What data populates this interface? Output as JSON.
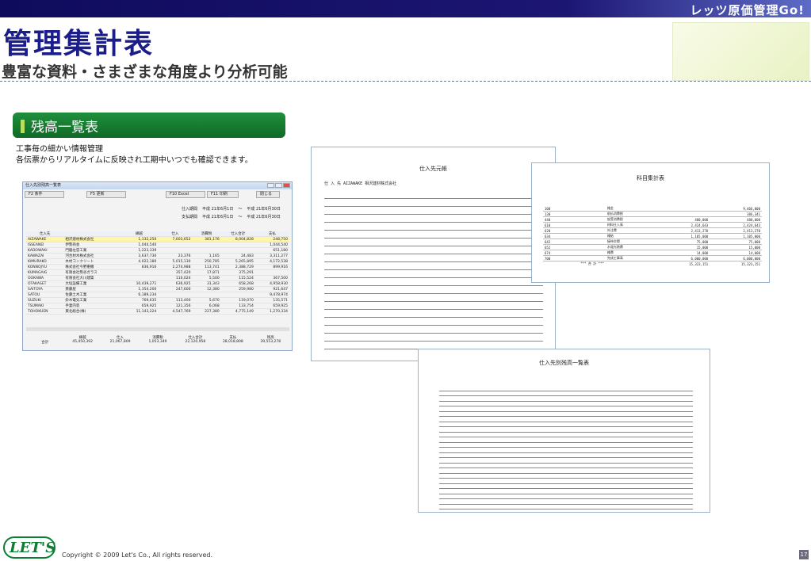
{
  "brand": "レッツ原価管理Go!",
  "title": "管理集計表",
  "subtitle": "豊富な資料・さまざまな角度より分析可能",
  "section": "残高一覧表",
  "description": [
    "工事毎の細かい情報管理",
    "各伝票からリアルタイムに反映され工期中いつでも確認できます。"
  ],
  "app": {
    "window_title": "仕入先別残高一覧表",
    "buttons": [
      "F2 条件",
      "F5 更新",
      "F10 Excel",
      "F11 印刷",
      "閉じる"
    ],
    "periods": [
      {
        "label": "仕入期間",
        "from": "平成 21年6月1日",
        "sep": "〜",
        "to": "平成 21年6月30日"
      },
      {
        "label": "支払期間",
        "from": "平成 21年6月1日",
        "sep": "〜",
        "to": "平成 21年6月30日"
      }
    ],
    "columns": [
      "仕入先",
      "",
      "繰越",
      "仕入",
      "消費税",
      "仕入合計",
      "支払",
      "残高"
    ],
    "rows": [
      [
        "AIZAWAKE",
        "相沢建材株式会社",
        "1,132,250",
        "7,603,652",
        "381,176",
        "8,004,828",
        "248,750",
        ""
      ],
      [
        "ISSEANEI",
        "伊勢商会",
        "1,044,540",
        "",
        "",
        "",
        "1,044,540",
        ""
      ],
      [
        "KADOWAKI",
        "門脇左官工業",
        "1,223,339",
        "",
        "",
        "",
        "651,180",
        ""
      ],
      [
        "KAWAZAI",
        "河合材木株式会社",
        "3,637,730",
        "23,376",
        "1,165",
        "24,483",
        "3,311,277",
        ""
      ],
      [
        "KIMURAKO",
        "木村コンクリート",
        "4,022,180",
        "5,015,130",
        "250,785",
        "5,265,895",
        "4,172,538",
        ""
      ],
      [
        "KONNOJYU",
        "株式会社今野重機",
        "836,916",
        "2,274,988",
        "113,741",
        "2,388,729",
        "899,916",
        ""
      ],
      [
        "KUMAGAIG",
        "有限会社熊谷ガラス",
        "",
        "357,420",
        "17,871",
        "375,291",
        "",
        ""
      ],
      [
        "OOKAWA",
        "有限会社大川建築",
        "",
        "110,024",
        "5,500",
        "115,524",
        "367,500",
        ""
      ],
      [
        "OTAKASET",
        "大垣設備工業",
        "10,439,271",
        "636,925",
        "31,343",
        "658,268",
        "4,958,930",
        ""
      ],
      [
        "SAITOYA",
        "斎藤屋",
        "1,354,200",
        "247,600",
        "12,380",
        "259,980",
        "921,647",
        ""
      ],
      [
        "SATOU",
        "佐藤土木工業",
        "6,189,234",
        "",
        "",
        "",
        "9,478,974",
        ""
      ],
      [
        "SUZUKI",
        "鈴木電気工業",
        "769,635",
        "113,400",
        "5,670",
        "119,070",
        "135,571",
        ""
      ],
      [
        "TSUMAKI",
        "手妻内装",
        "659,925",
        "121,356",
        "6,068",
        "133,754",
        "659,925",
        ""
      ],
      [
        "TOHOKUEN",
        "東北総合(株)",
        "11,143,224",
        "4,547,769",
        "227,380",
        "4,775,149",
        "1,270,334",
        ""
      ]
    ],
    "totals_labels": [
      "繰越",
      "仕入",
      "消費税",
      "仕入合計",
      "支払",
      "残高"
    ],
    "totals_label": "合計",
    "totals_values": [
      "45,450,392",
      "21,067,809",
      "1,053,349",
      "22,120,958",
      "28,018,808",
      "39,553,278"
    ]
  },
  "doc1": {
    "title": "仕入先元帳",
    "supplier": "仕 入 先  AIZAWAKE  相沢建材株式会社"
  },
  "doc2": {
    "title": "科目集計表",
    "rows": [
      [
        "100",
        "雑金",
        "",
        "",
        "9,466,000"
      ],
      [
        "130",
        "前払消費税",
        "",
        "",
        "386,341"
      ],
      [
        "440",
        "仮受消費税",
        "",
        "480,000",
        "480,000"
      ],
      [
        "610",
        "材料仕入高",
        "",
        "2,424,643",
        "2,424,643"
      ],
      [
        "620",
        "外注費",
        "",
        "2,413,270",
        "2,413,270"
      ],
      [
        "634",
        "雑給",
        "",
        "1,105,000",
        "1,105,000"
      ],
      [
        "642",
        "接待交際",
        "",
        "75,000",
        "75,000"
      ],
      [
        "652",
        "水道光熱費",
        "",
        "15,000",
        "15,000"
      ],
      [
        "674",
        "雑費",
        "",
        "14,000",
        "14,000"
      ],
      [
        "700",
        "完成工事高",
        "",
        "6,000,000",
        "6,000,000"
      ]
    ],
    "total": [
      "*** 合 計 ***",
      "15,323,151",
      "15,323,151"
    ]
  },
  "doc3": {
    "title": "仕入先別残高一覧表"
  },
  "copyright": "Copyright © 2009 Let's Co., All rights reserved.",
  "logo": "LET'S",
  "page_number": "17"
}
